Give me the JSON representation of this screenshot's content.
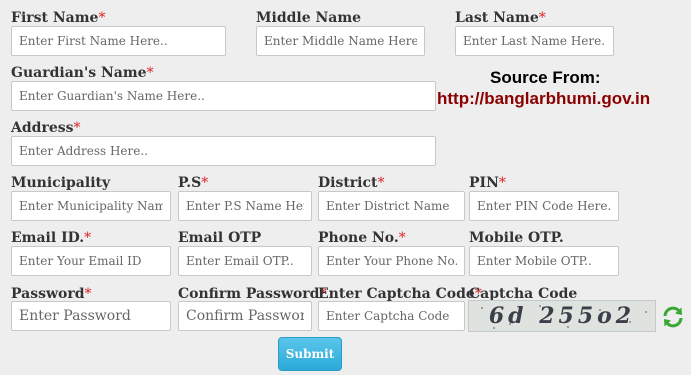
{
  "form": {
    "first_name": {
      "label": "First Name",
      "required": "*",
      "placeholder": "Enter First Name Here.."
    },
    "middle_name": {
      "label": "Middle Name",
      "placeholder": "Enter Middle Name Here.."
    },
    "last_name": {
      "label": "Last Name",
      "required": "*",
      "placeholder": "Enter Last Name Here.."
    },
    "guardian_name": {
      "label": "Guardian's Name",
      "required": "*",
      "placeholder": "Enter Guardian's Name Here.."
    },
    "address": {
      "label": "Address",
      "required": "*",
      "placeholder": "Enter Address Here.."
    },
    "municipality": {
      "label": "Municipality",
      "placeholder": "Enter Municipality Name"
    },
    "ps": {
      "label": "P.S",
      "required": "*",
      "placeholder": "Enter P.S Name Here"
    },
    "district": {
      "label": "District",
      "required": "*",
      "placeholder": "Enter District Name"
    },
    "pin": {
      "label": "PIN",
      "required": "*",
      "placeholder": "Enter PIN Code Here.."
    },
    "email": {
      "label": "Email ID.",
      "required": "*",
      "placeholder": "Enter Your Email ID"
    },
    "email_otp": {
      "label": "Email OTP",
      "placeholder": "Enter Email OTP.."
    },
    "phone": {
      "label": "Phone No.",
      "required": "*",
      "placeholder": "Enter Your Phone No."
    },
    "mobile_otp": {
      "label": "Mobile OTP.",
      "placeholder": "Enter Mobile OTP.."
    },
    "password": {
      "label": "Password",
      "required": "*",
      "placeholder": "Enter Password"
    },
    "confirm_password": {
      "label": "Confirm Password",
      "required": "*",
      "placeholder": "Confirm Password"
    },
    "captcha_code": {
      "label": "Enter Captcha Code",
      "required": "*",
      "placeholder": "Enter Captcha Code"
    },
    "captcha": {
      "label": "Captcha Code",
      "text": "6d 255o2"
    },
    "submit_label": "Submit"
  },
  "source": {
    "heading": "Source From:",
    "url": "http://banglarbhumi.gov.in",
    "heading_color": "#000000",
    "url_color": "#8b0000"
  },
  "icons": {
    "refresh": "refresh-icon"
  }
}
